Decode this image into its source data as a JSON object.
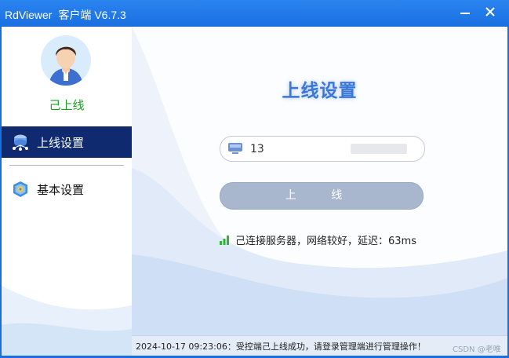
{
  "window": {
    "app_name": "RdViewer",
    "client_label": "客户端 V6.7.3"
  },
  "sidebar": {
    "user_status": "己上线",
    "items": [
      {
        "label": "上线设置",
        "icon": "network-icon",
        "active": true
      },
      {
        "label": "基本设置",
        "icon": "shield-settings-icon",
        "active": false
      }
    ]
  },
  "main": {
    "title": "上线设置",
    "id_field": {
      "value": "13",
      "icon": "monitor-icon"
    },
    "online_button": "上 线",
    "connection_status": "己连接服务器，网络较好，延迟：63ms"
  },
  "status_bar": {
    "message": "2024-10-17 09:23:06：受控端己上线成功，请登录管理端进行管理操作！"
  },
  "watermark": "CSDN @老唯",
  "colors": {
    "titlebar": "#1a6fe0",
    "nav_active": "#0f2a6e",
    "online_status": "#16a21f",
    "button": "#a8b7cd"
  }
}
